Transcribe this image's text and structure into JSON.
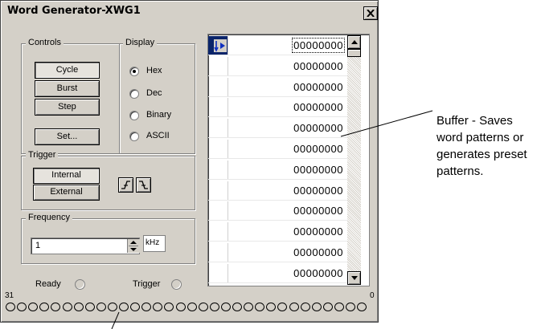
{
  "window": {
    "title": "Word Generator-XWG1"
  },
  "controls": {
    "label": "Controls",
    "cycle": "Cycle",
    "burst": "Burst",
    "step": "Step",
    "set": "Set..."
  },
  "display": {
    "label": "Display",
    "options": [
      "Hex",
      "Dec",
      "Binary",
      "ASCII"
    ],
    "selected": "Hex"
  },
  "trigger": {
    "label": "Trigger",
    "internal": "Internal",
    "external": "External"
  },
  "frequency": {
    "label": "Frequency",
    "value": "1",
    "unit": "kHz"
  },
  "status": {
    "ready": "Ready",
    "trigger": "Trigger"
  },
  "bits": {
    "high": "31",
    "low": "0",
    "count": 32
  },
  "buffer": {
    "rows": [
      "00000000",
      "00000000",
      "00000000",
      "00000000",
      "00000000",
      "00000000",
      "00000000",
      "00000000",
      "00000000",
      "00000000",
      "00000000",
      "00000000"
    ]
  },
  "annotation": {
    "text": "Buffer - Saves word patterns or generates preset patterns."
  },
  "icons": {
    "close": "close-icon",
    "rising_edge": "rising-edge-icon",
    "falling_edge": "falling-edge-icon",
    "scroll_up": "scroll-up-icon",
    "scroll_down": "scroll-down-icon"
  }
}
